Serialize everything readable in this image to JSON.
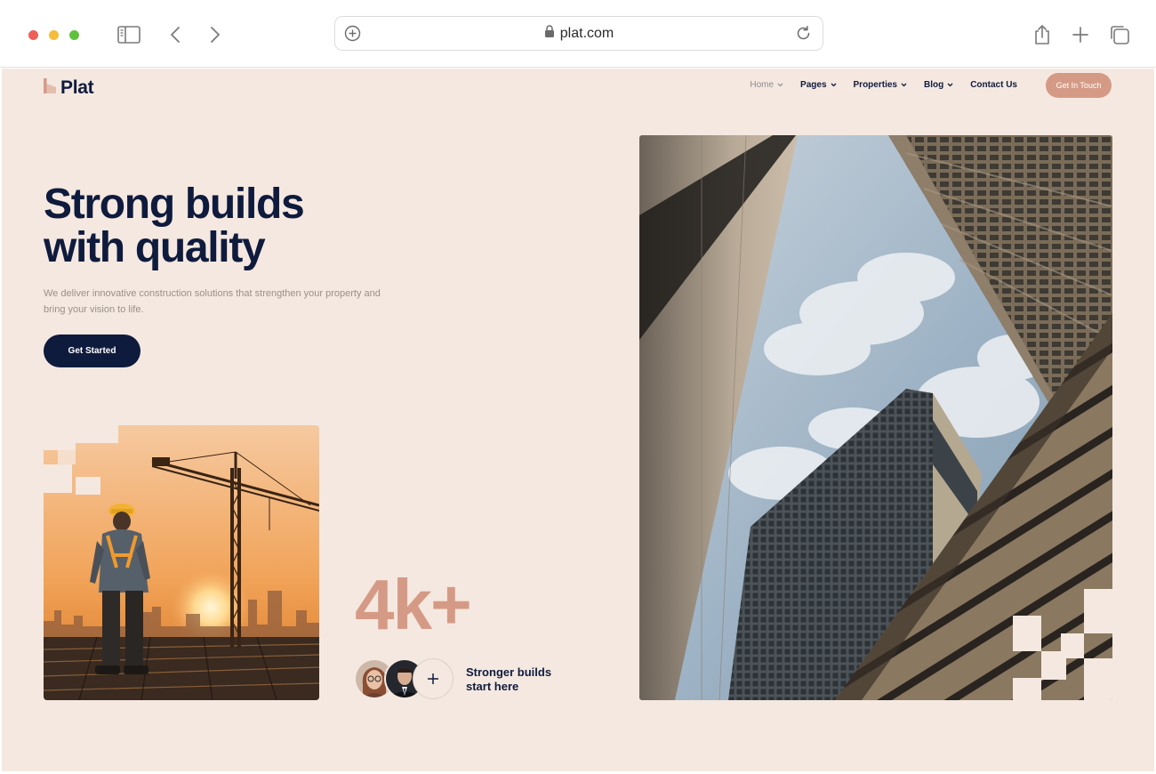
{
  "browser": {
    "url": "plat.com"
  },
  "brand": {
    "name": "Plat",
    "accent": "#d59a85",
    "navy": "#0f1b3d",
    "background": "#f4e8e0"
  },
  "nav": {
    "items": [
      {
        "label": "Home",
        "has_dropdown": true,
        "active": true
      },
      {
        "label": "Pages",
        "has_dropdown": true
      },
      {
        "label": "Properties",
        "has_dropdown": true
      },
      {
        "label": "Blog",
        "has_dropdown": true
      },
      {
        "label": "Contact Us",
        "has_dropdown": false
      }
    ],
    "cta_label": "Get In Touch"
  },
  "hero": {
    "title_line1": "Strong builds",
    "title_line2": "with quality",
    "subtitle": "We deliver innovative construction solutions that strengthen your property and bring your vision to life.",
    "button_label": "Get Started"
  },
  "stats": {
    "value": "4k+",
    "caption_line1": "Stronger builds",
    "caption_line2": "start here"
  },
  "icons": {
    "sidebar": "sidebar-icon",
    "back": "chevron-left-icon",
    "forward": "chevron-right-icon",
    "share": "share-icon",
    "new_tab": "plus-icon",
    "tabs": "tabs-icon",
    "lock": "lock-icon",
    "reload": "reload-icon"
  }
}
